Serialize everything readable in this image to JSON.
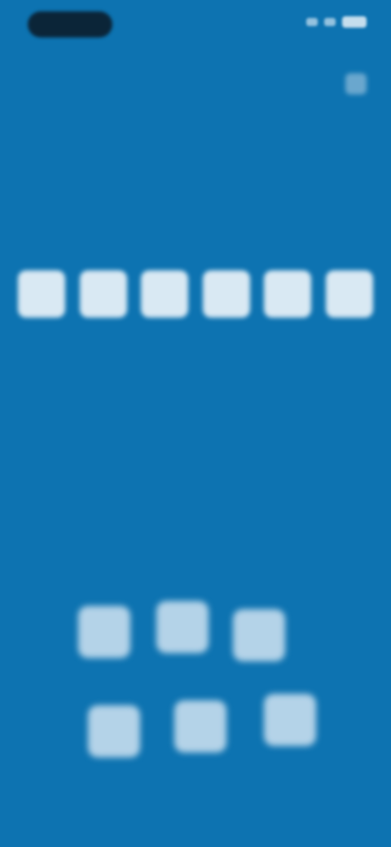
{
  "status_bar": {
    "time": "",
    "battery": ""
  },
  "header": {
    "title": "",
    "subtitle": ""
  },
  "prompt": {
    "text": ""
  },
  "code_inputs": [
    "",
    "",
    "",
    "",
    "",
    ""
  ],
  "keypad": {
    "keys": [
      "",
      "",
      "",
      "",
      "",
      ""
    ]
  },
  "colors": {
    "background": "#0d73b1",
    "code_box": "#d9e9f3",
    "key": "#b4d3e8",
    "status_pill": "#0b1d2c"
  }
}
